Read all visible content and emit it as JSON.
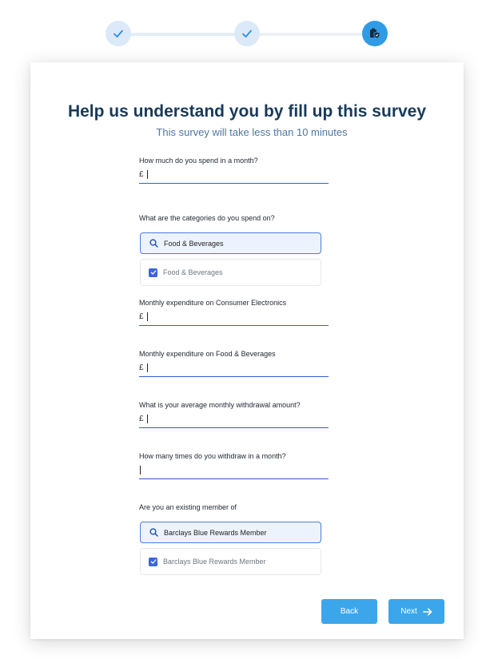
{
  "stepper": {
    "steps": [
      {
        "state": "done",
        "icon": "check-icon"
      },
      {
        "state": "done",
        "icon": "check-icon"
      },
      {
        "state": "current",
        "icon": "document-shield-icon"
      }
    ],
    "colors": {
      "done_bg": "#dce9f8",
      "check": "#2f8fe0",
      "current_bg": "#2f9be6"
    }
  },
  "survey": {
    "title": "Help us understand you by fill up this survey",
    "subtitle": "This survey will take less than 10 minutes",
    "q_spend": {
      "label": "How much do you spend in a month?",
      "prefix": "£",
      "value": ""
    },
    "q_categories": {
      "label": "What are the categories do you spend on?",
      "search_value": "Food & Beverages",
      "option": {
        "label": "Food & Beverages",
        "checked": true
      }
    },
    "q_electronics": {
      "label": "Monthly expenditure on Consumer Electronics",
      "prefix": "£",
      "value": ""
    },
    "q_food": {
      "label": "Monthly expenditure on Food & Beverages",
      "prefix": "£",
      "value": ""
    },
    "q_withdrawal": {
      "label": "What is your average monthly withdrawal amount?",
      "prefix": "£",
      "value": ""
    },
    "q_times": {
      "label": "How many times do you withdraw in a month?",
      "value": ""
    },
    "q_member": {
      "label": "Are you an existing member of",
      "search_value": "Barclays Blue Rewards Member",
      "option": {
        "label": "Barclays Blue Rewards Member",
        "checked": true
      }
    }
  },
  "actions": {
    "back_label": "Back",
    "next_label": "Next"
  },
  "theme": {
    "accent": "#3ca6ea",
    "input_underline": "#2f5bd6",
    "title_color": "#183a5a",
    "subtitle_color": "#4e77a0"
  }
}
